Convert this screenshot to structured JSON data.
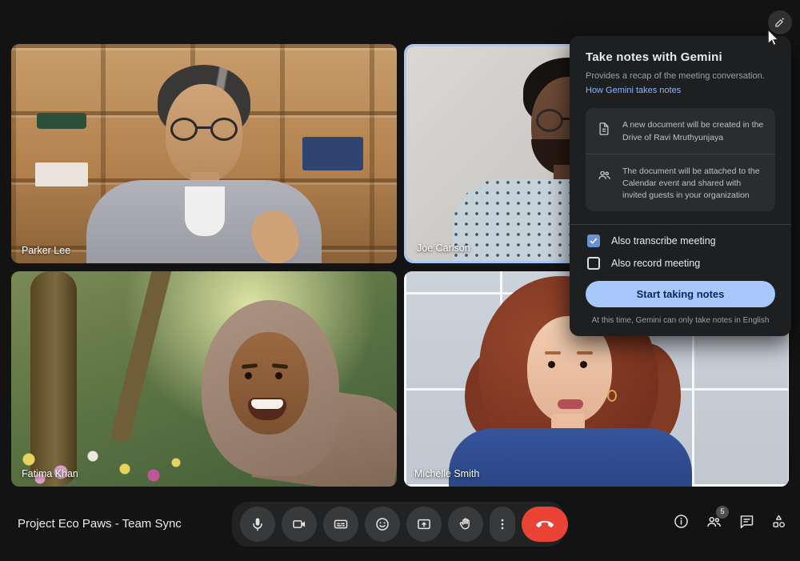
{
  "meeting": {
    "title": "Project Eco Paws - Team Sync"
  },
  "participants": [
    {
      "name": "Parker Lee",
      "active": false
    },
    {
      "name": "Joe Carlson",
      "active": true
    },
    {
      "name": "Fatima Khan",
      "active": false
    },
    {
      "name": "Michelle Smith",
      "active": false
    }
  ],
  "gemini_panel": {
    "title": "Take notes with Gemini",
    "subtitle": "Provides a recap of the meeting conversation.",
    "link_label": "How Gemini takes notes",
    "info_items": [
      {
        "icon": "document-icon",
        "text": "A new document will be created in the Drive of Ravi Mruthyunjaya"
      },
      {
        "icon": "group-icon",
        "text": "The document will be attached to the Calendar event and shared with invited guests in your organization"
      }
    ],
    "options": [
      {
        "label": "Also transcribe meeting",
        "checked": true
      },
      {
        "label": "Also record meeting",
        "checked": false
      }
    ],
    "primary_button": "Start taking notes",
    "footnote": "At this time, Gemini can only take notes in English"
  },
  "toolbar": {
    "controls": [
      "microphone",
      "camera",
      "captions",
      "emoji-reactions",
      "present-screen",
      "raise-hand",
      "more-options",
      "end-call"
    ]
  },
  "side_actions": {
    "badge_count": "5",
    "icons": [
      "meeting-details",
      "people",
      "chat",
      "activities"
    ]
  },
  "header": {
    "icons": [
      "gemini-pen-spark"
    ]
  },
  "colors": {
    "page_bg": "#131314",
    "panel_bg": "#1e1f20",
    "accent_blue": "#a8c7fa",
    "link_blue": "#8ab4f8",
    "checkbox_blue": "#6991d6",
    "active_speaker_border": "#a8c7fa",
    "end_call_red": "#ea4335"
  }
}
